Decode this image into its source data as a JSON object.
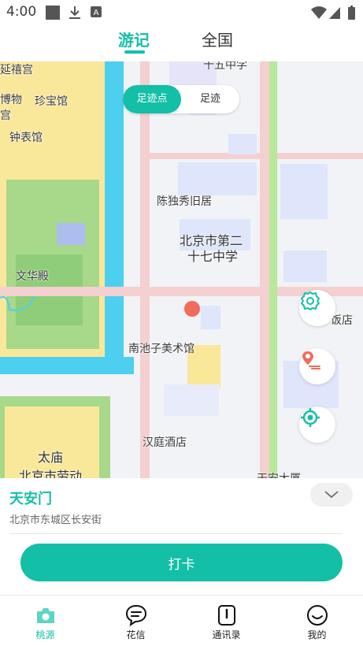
{
  "status_bar": {
    "time": "4:00"
  },
  "header": {
    "tabs": [
      {
        "label": "游记",
        "active": true
      },
      {
        "label": "全国",
        "active": false
      }
    ]
  },
  "map": {
    "mode_switch": {
      "active": "足迹点",
      "inactive": "足迹"
    },
    "labels": {
      "yanxi": "延禧宫",
      "museum": "博物",
      "palace": "宫",
      "treasure": "珍宝馆",
      "clock": "钟表馆",
      "wenhua": "文华殿",
      "chenduxiu": "陈独秀旧居",
      "school_1": "北京市第二",
      "school_2": "十七中学",
      "shiwu": "十五中学",
      "nanchizi": "南池子美术馆",
      "hanting": "汉庭酒店",
      "taimiao": "太庙",
      "laodong": "北京市劳动",
      "hotel": "饭店",
      "tianan": "天安大厦"
    }
  },
  "place": {
    "name": "天安门",
    "address": "北京市东城区长安街"
  },
  "checkin_label": "打卡",
  "nav": [
    {
      "label": "桃源",
      "active": true
    },
    {
      "label": "花信",
      "active": false
    },
    {
      "label": "通讯录",
      "active": false
    },
    {
      "label": "我的",
      "active": false
    }
  ],
  "colors": {
    "accent": "#13bfa6",
    "marker": "#f26b5b",
    "water": "#4dcff0",
    "park": "#a8d88a",
    "palace": "#fae89a"
  }
}
